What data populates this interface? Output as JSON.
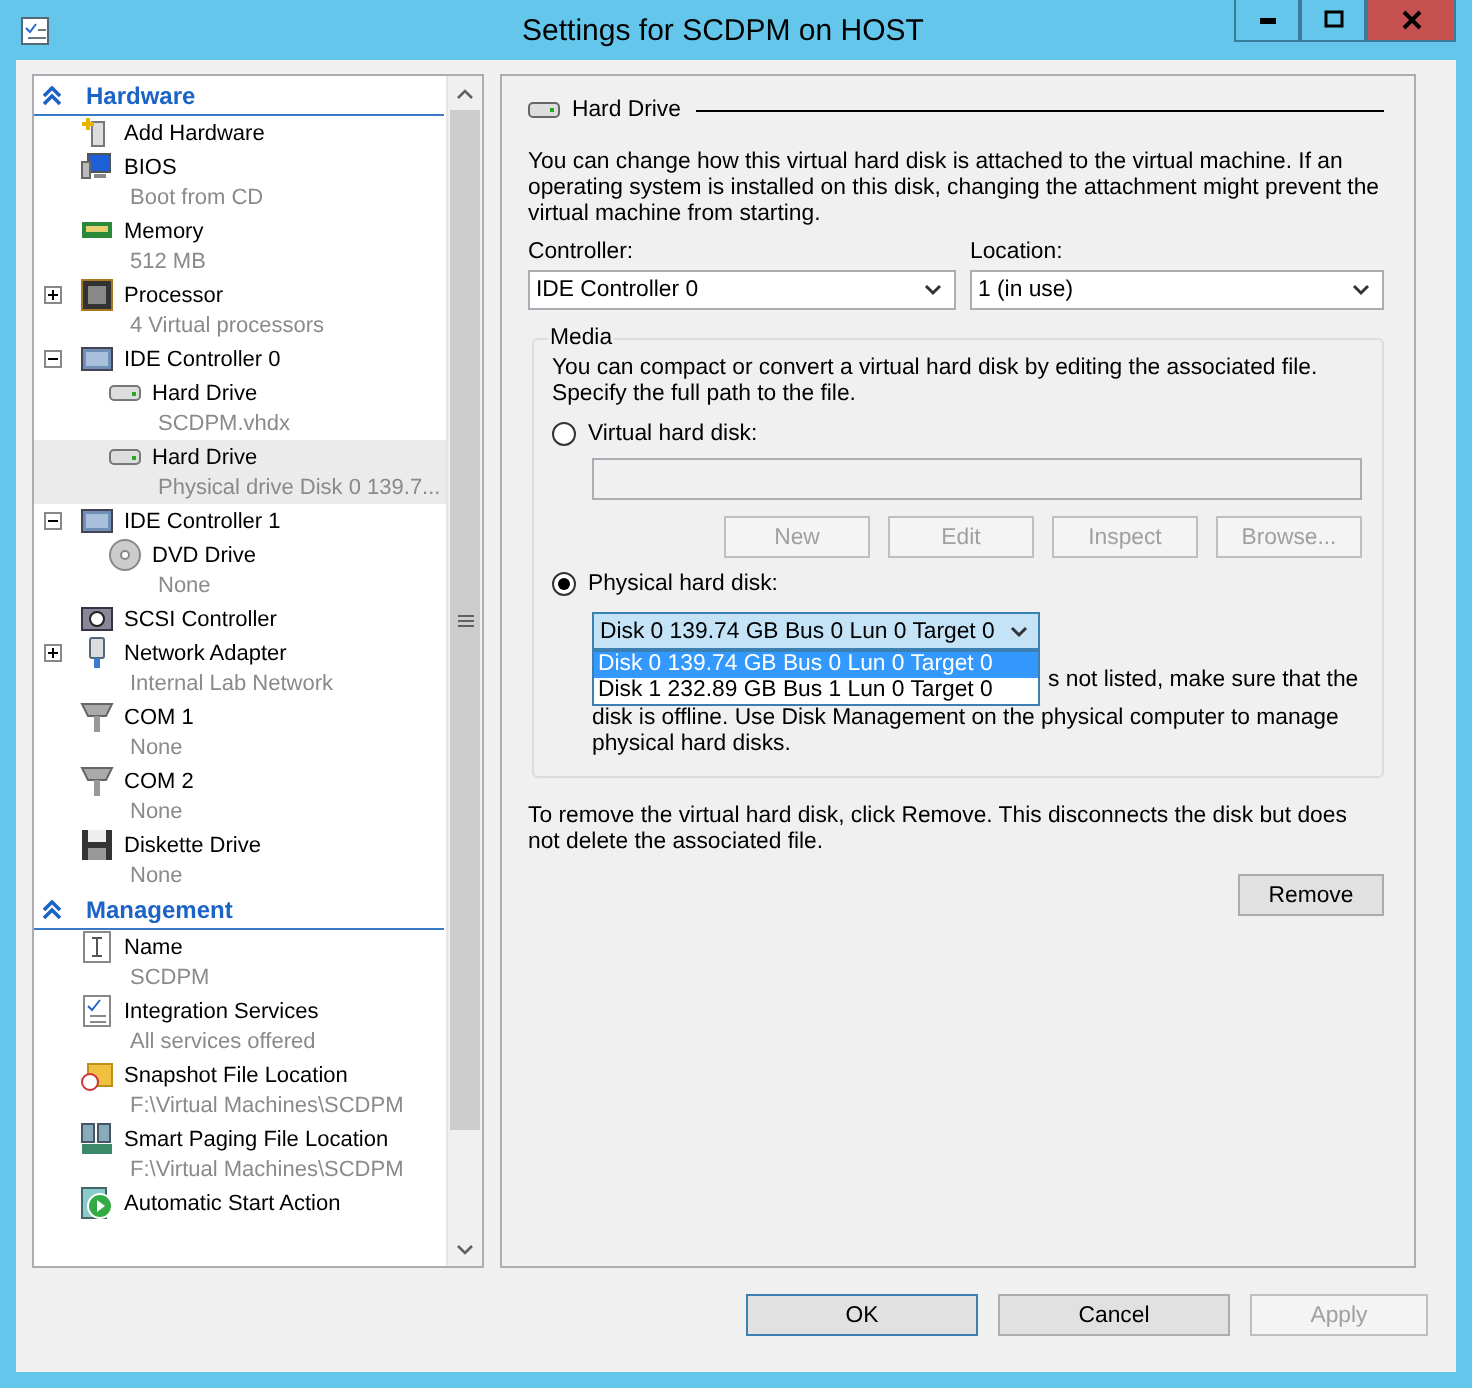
{
  "window": {
    "title": "Settings for SCDPM on HOST"
  },
  "tree": {
    "sections": [
      {
        "title": "Hardware",
        "items": [
          {
            "kind": "addhw",
            "label": "Add Hardware",
            "selected": false
          },
          {
            "kind": "bios",
            "label": "BIOS",
            "sub": "Boot from CD",
            "selected": false
          },
          {
            "kind": "memory",
            "label": "Memory",
            "sub": "512 MB",
            "selected": false
          },
          {
            "kind": "cpu",
            "label": "Processor",
            "sub": "4 Virtual processors",
            "expanded": false,
            "selected": false
          },
          {
            "kind": "controller",
            "label": "IDE Controller 0",
            "expanded": true,
            "selected": false,
            "children": [
              {
                "kind": "disk",
                "label": "Hard Drive",
                "sub": "SCDPM.vhdx",
                "selected": false
              },
              {
                "kind": "disk",
                "label": "Hard Drive",
                "sub": "Physical drive Disk 0 139.7...",
                "selected": true
              }
            ]
          },
          {
            "kind": "controller",
            "label": "IDE Controller 1",
            "expanded": true,
            "selected": false,
            "children": [
              {
                "kind": "dvd",
                "label": "DVD Drive",
                "sub": "None",
                "selected": false
              }
            ]
          },
          {
            "kind": "scsi",
            "label": "SCSI Controller",
            "selected": false
          },
          {
            "kind": "network",
            "label": "Network Adapter",
            "sub": "Internal Lab Network",
            "expanded": false,
            "selected": false
          },
          {
            "kind": "com",
            "label": "COM 1",
            "sub": "None",
            "selected": false
          },
          {
            "kind": "com",
            "label": "COM 2",
            "sub": "None",
            "selected": false
          },
          {
            "kind": "floppy",
            "label": "Diskette Drive",
            "sub": "None",
            "selected": false
          }
        ]
      },
      {
        "title": "Management",
        "items": [
          {
            "kind": "name",
            "label": "Name",
            "sub": "SCDPM",
            "selected": false
          },
          {
            "kind": "services",
            "label": "Integration Services",
            "sub": "All services offered",
            "selected": false
          },
          {
            "kind": "snapshot",
            "label": "Snapshot File Location",
            "sub": "F:\\Virtual Machines\\SCDPM",
            "selected": false
          },
          {
            "kind": "paging",
            "label": "Smart Paging File Location",
            "sub": "F:\\Virtual Machines\\SCDPM",
            "selected": false
          },
          {
            "kind": "autostart",
            "label": "Automatic Start Action",
            "selected": false
          }
        ]
      }
    ]
  },
  "panel": {
    "title": "Hard Drive",
    "intro": "You can change how this virtual hard disk is attached to the virtual machine. If an operating system is installed on this disk, changing the attachment might prevent the virtual machine from starting.",
    "controller": {
      "label": "Controller:",
      "value": "IDE Controller 0"
    },
    "location": {
      "label": "Location:",
      "value": "1 (in use)"
    },
    "media": {
      "title": "Media",
      "text": "You can compact or convert a virtual hard disk by editing the associated file. Specify the full path to the file.",
      "virtual": {
        "label": "Virtual hard disk:",
        "selected": false
      },
      "file_buttons": [
        {
          "label": "New",
          "disabled": true
        },
        {
          "label": "Edit",
          "disabled": true
        },
        {
          "label": "Inspect",
          "disabled": true
        },
        {
          "label": "Browse...",
          "disabled": true
        }
      ],
      "physical": {
        "label": "Physical hard disk:",
        "selected": true
      },
      "disk_dropdown": {
        "value": "Disk 0 139.74 GB Bus 0 Lun 0 Target 0",
        "open": true,
        "options": [
          {
            "label": "Disk 0 139.74 GB Bus 0 Lun 0 Target 0",
            "selected": true
          },
          {
            "label": "Disk 1 232.89 GB Bus 1 Lun 0 Target 0",
            "selected": false
          }
        ]
      },
      "note_lines": [
        "s not listed, make sure that the",
        "disk is offline. Use Disk Management on the physical computer to manage physical hard disks."
      ]
    },
    "remove_text": "To remove the virtual hard disk, click Remove. This disconnects the disk but does not delete the associated file.",
    "remove_button": "Remove"
  },
  "buttons": [
    {
      "label": "OK",
      "default": true,
      "disabled": false
    },
    {
      "label": "Cancel",
      "default": false,
      "disabled": false
    },
    {
      "label": "Apply",
      "default": false,
      "disabled": true
    }
  ]
}
